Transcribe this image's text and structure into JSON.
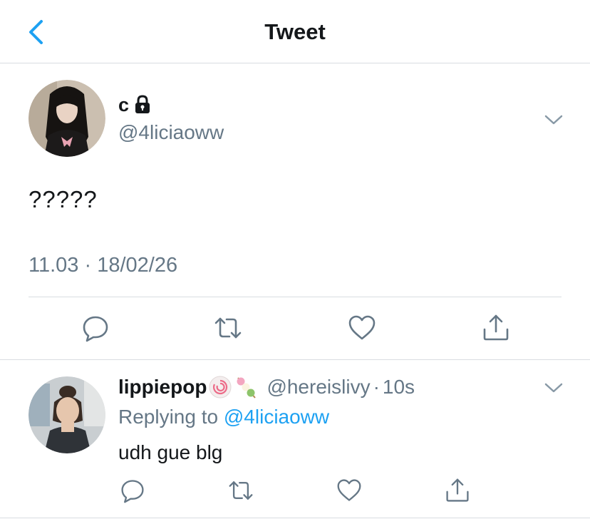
{
  "header": {
    "title": "Tweet",
    "back_icon": "chevron-left-icon",
    "accent": "#1da1f2"
  },
  "tweet": {
    "display_name": "c",
    "protected_icon": "lock-icon",
    "handle": "@4liciaoww",
    "text": "?????",
    "timestamp": "11.03 · 18/02/26",
    "actions": [
      "reply-icon",
      "retweet-icon",
      "like-icon",
      "share-icon"
    ]
  },
  "reply": {
    "display_name": "lippiepop",
    "emojis": [
      "narutomaki-emoji",
      "dango-emoji"
    ],
    "handle": "@hereislivy",
    "dot": "·",
    "age": "10s",
    "replying_label": "Replying to ",
    "replying_to": "@4liciaoww",
    "text": "udh gue blg",
    "actions": [
      "reply-icon",
      "retweet-icon",
      "like-icon",
      "share-icon"
    ]
  },
  "colors": {
    "text": "#14171a",
    "secondary": "#657786",
    "link": "#1da1f2",
    "divider": "#d9dde1"
  }
}
